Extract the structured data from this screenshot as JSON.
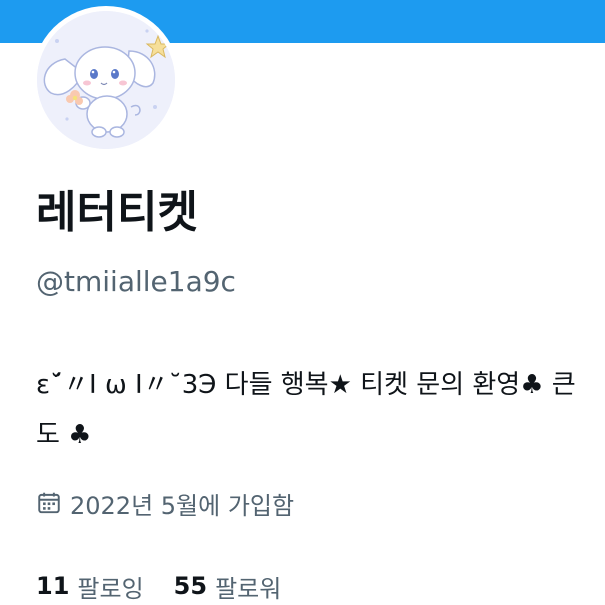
{
  "colors": {
    "banner": "#1d9bf0",
    "primary_text": "#0f1419",
    "secondary_text": "#536471"
  },
  "profile": {
    "avatar_icon": "cinnamoroll-avatar",
    "display_name": "레터티켓",
    "handle": "@tmiialle1a9c",
    "bio_line1": "ε˘́〃Ι ω Ι〃˘3Э 다들 행복★ 티켓 문의 환영♣ 큰",
    "bio_line2": "도 ♣",
    "joined": "2022년 5월에 가입함",
    "joined_icon": "calendar-icon"
  },
  "stats": {
    "following_count": "11",
    "following_label": "팔로잉",
    "followers_count": "55",
    "followers_label": "팔로워"
  }
}
